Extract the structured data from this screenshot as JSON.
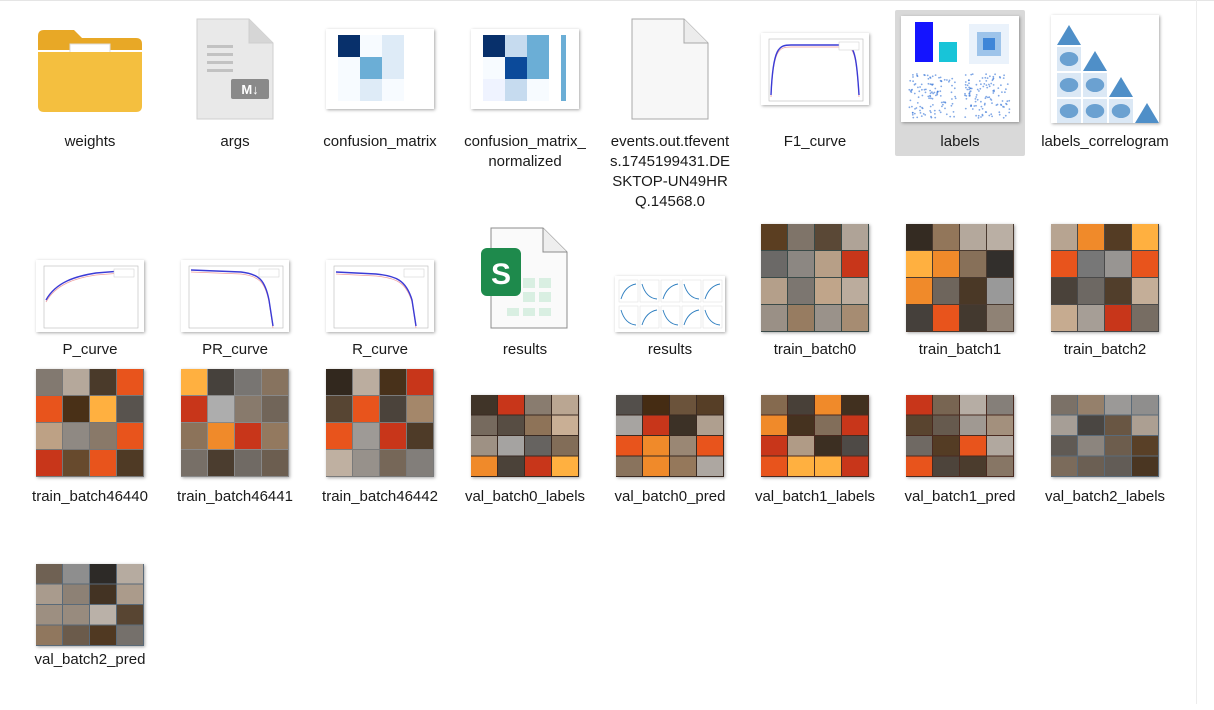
{
  "window": {
    "title": ""
  },
  "files": [
    {
      "name": "weights",
      "icon": "folder-icon",
      "kind": "folder"
    },
    {
      "name": "args",
      "icon": "markdown-file-icon",
      "kind": "md"
    },
    {
      "name": "confusion_matrix",
      "icon": "confusion-matrix-thumbnail",
      "kind": "cm"
    },
    {
      "name": "confusion_matrix_normalized",
      "icon": "confusion-matrix-normalized-thumbnail",
      "kind": "cmn"
    },
    {
      "name": "events.out.tfevents.1745199431.DESKTOP-UN49HRQ.14568.0",
      "icon": "blank-file-icon",
      "kind": "blank"
    },
    {
      "name": "F1_curve",
      "icon": "f1-curve-thumbnail",
      "kind": "curve"
    },
    {
      "name": "labels",
      "icon": "labels-thumbnail",
      "kind": "labels",
      "selected": true
    },
    {
      "name": "labels_correlogram",
      "icon": "correlogram-thumbnail",
      "kind": "corr"
    },
    {
      "name": "P_curve",
      "icon": "p-curve-thumbnail",
      "kind": "pcurve"
    },
    {
      "name": "PR_curve",
      "icon": "pr-curve-thumbnail",
      "kind": "prcurve"
    },
    {
      "name": "R_curve",
      "icon": "r-curve-thumbnail",
      "kind": "rcurve"
    },
    {
      "name": "results",
      "icon": "spreadsheet-file-icon",
      "kind": "sheet",
      "badge": "S"
    },
    {
      "name": "results",
      "icon": "results-plot-thumbnail",
      "kind": "results"
    },
    {
      "name": "train_batch0",
      "icon": "train-batch-thumbnail",
      "kind": "batch",
      "tone": "#3a4a48"
    },
    {
      "name": "train_batch1",
      "icon": "train-batch-thumbnail",
      "kind": "batch",
      "tone": "#4a3a30"
    },
    {
      "name": "train_batch2",
      "icon": "train-batch-thumbnail",
      "kind": "batch",
      "tone": "#4a4a4a"
    },
    {
      "name": "train_batch46440",
      "icon": "train-batch-thumbnail",
      "kind": "batchsq",
      "tone": "#777777"
    },
    {
      "name": "train_batch46441",
      "icon": "train-batch-thumbnail",
      "kind": "batchsq",
      "tone": "#888888"
    },
    {
      "name": "train_batch46442",
      "icon": "train-batch-thumbnail",
      "kind": "batchsq",
      "tone": "#7a7a7a"
    },
    {
      "name": "val_batch0_labels",
      "icon": "val-batch-thumbnail",
      "kind": "val",
      "tone": "#3a2a22"
    },
    {
      "name": "val_batch0_pred",
      "icon": "val-batch-thumbnail",
      "kind": "val",
      "tone": "#3a2a22"
    },
    {
      "name": "val_batch1_labels",
      "icon": "val-batch-thumbnail",
      "kind": "val",
      "tone": "#4a2a20"
    },
    {
      "name": "val_batch1_pred",
      "icon": "val-batch-thumbnail",
      "kind": "val",
      "tone": "#4a2a20"
    },
    {
      "name": "val_batch2_labels",
      "icon": "val-batch-thumbnail",
      "kind": "valsky",
      "tone": "#5a6a78"
    },
    {
      "name": "val_batch2_pred",
      "icon": "val-batch-thumbnail",
      "kind": "valsky",
      "tone": "#5a6a78"
    }
  ],
  "colors": {
    "folder": "#f4bf3f",
    "folderDark": "#e8a826",
    "selection": "#d9d9d9",
    "sheetGreen": "#1e8a4c",
    "cmDark": "#08306b",
    "cmMid": "#6baed6",
    "cmLight": "#deebf7",
    "curveBlue": "#3b3bd6",
    "fire": "#e8541c"
  }
}
